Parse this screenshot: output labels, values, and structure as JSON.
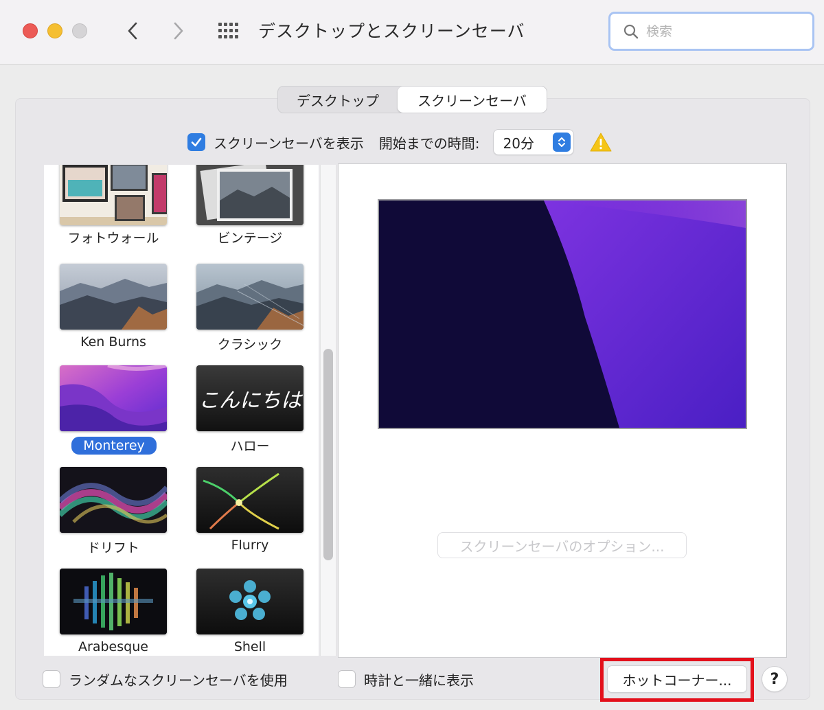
{
  "window": {
    "title": "デスクトップとスクリーンセーバ",
    "search_placeholder": "検索"
  },
  "tabs": [
    {
      "label": "デスクトップ",
      "selected": false
    },
    {
      "label": "スクリーンセーバ",
      "selected": true
    }
  ],
  "options": {
    "show_screensaver_label": "スクリーンセーバを表示",
    "show_screensaver_checked": true,
    "start_after_label": "開始までの時間:",
    "start_after_value": "20分",
    "warning_icon": "warning-triangle-icon"
  },
  "screensavers": [
    {
      "label": "フォトウォール",
      "selected": false
    },
    {
      "label": "ビンテージ",
      "selected": false
    },
    {
      "label": "Ken Burns",
      "selected": false
    },
    {
      "label": "クラシック",
      "selected": false
    },
    {
      "label": "Monterey",
      "selected": true
    },
    {
      "label": "ハロー",
      "selected": false,
      "thumb_text": "こんにちは"
    },
    {
      "label": "ドリフト",
      "selected": false
    },
    {
      "label": "Flurry",
      "selected": false
    },
    {
      "label": "Arabesque",
      "selected": false
    },
    {
      "label": "Shell",
      "selected": false
    }
  ],
  "preview": {
    "options_button": "スクリーンセーバのオプション...",
    "options_enabled": false
  },
  "bottom": {
    "random_label": "ランダムなスクリーンセーバを使用",
    "random_checked": false,
    "clock_label": "時計と一緒に表示",
    "clock_checked": false,
    "hot_corners_button": "ホットコーナー...",
    "help_button": "?"
  },
  "colors": {
    "accent": "#2f7de1",
    "highlight_frame": "#e3101b"
  }
}
